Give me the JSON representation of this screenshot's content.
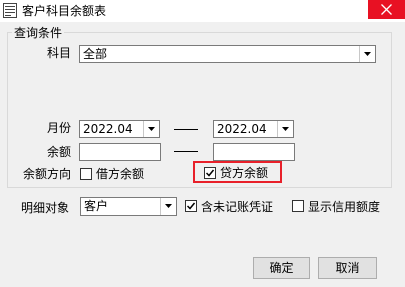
{
  "window": {
    "title": "客户科目余额表"
  },
  "query": {
    "group_title": "查询条件",
    "subject_label": "科目",
    "subject_value": "全部",
    "month_label": "月份",
    "month_from": "2022.04",
    "month_to": "2022.04",
    "balance_label": "余额",
    "balance_from": "",
    "balance_to": "",
    "direction_label": "余额方向",
    "debit_label": "借方余额",
    "debit_checked": false,
    "credit_label": "贷方余额",
    "credit_checked": true
  },
  "detail": {
    "object_label": "明细对象",
    "object_value": "客户",
    "include_unposted_label": "含未记账凭证",
    "include_unposted_checked": true,
    "show_credit_label": "显示信用额度",
    "show_credit_checked": false
  },
  "buttons": {
    "ok": "确定",
    "cancel": "取消"
  },
  "colors": {
    "highlight": "#e8202a",
    "close": "#e81123"
  }
}
